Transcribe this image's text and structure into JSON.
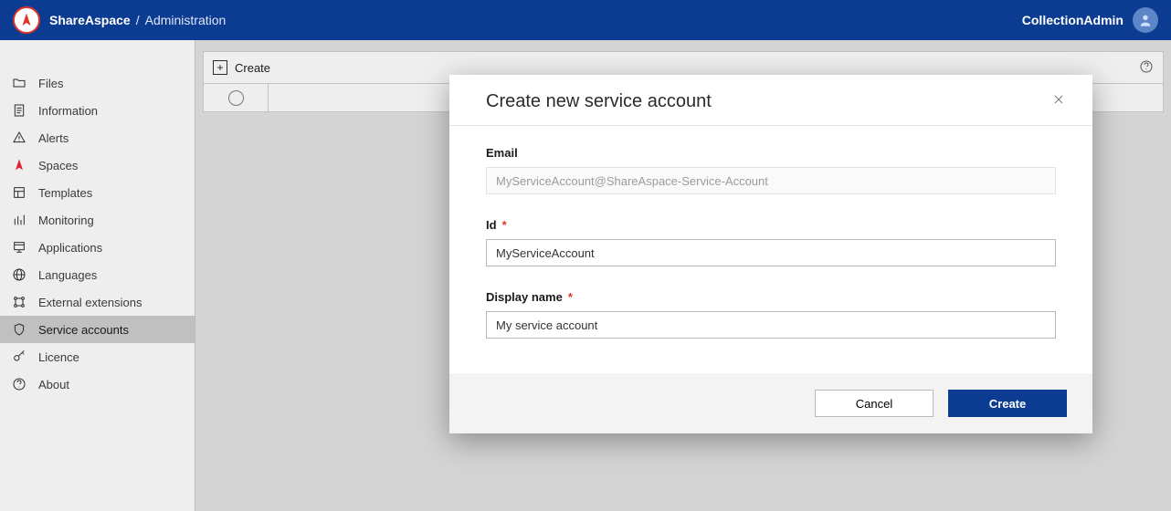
{
  "header": {
    "brand": "ShareAspace",
    "separator": "/",
    "section": "Administration",
    "user": "CollectionAdmin"
  },
  "sidebar": {
    "items": [
      {
        "icon": "folder-icon",
        "label": "Files"
      },
      {
        "icon": "document-icon",
        "label": "Information"
      },
      {
        "icon": "alert-icon",
        "label": "Alerts"
      },
      {
        "icon": "spaces-icon",
        "label": "Spaces"
      },
      {
        "icon": "template-icon",
        "label": "Templates"
      },
      {
        "icon": "monitoring-icon",
        "label": "Monitoring"
      },
      {
        "icon": "applications-icon",
        "label": "Applications"
      },
      {
        "icon": "globe-icon",
        "label": "Languages"
      },
      {
        "icon": "extensions-icon",
        "label": "External extensions"
      },
      {
        "icon": "shield-icon",
        "label": "Service accounts"
      },
      {
        "icon": "key-icon",
        "label": "Licence"
      },
      {
        "icon": "help-icon",
        "label": "About"
      }
    ],
    "active_index": 9
  },
  "toolbar": {
    "create_label": "Create"
  },
  "modal": {
    "title": "Create new service account",
    "email_label": "Email",
    "email_placeholder": "MyServiceAccount@ShareAspace-Service-Account",
    "id_label": "Id",
    "id_value": "MyServiceAccount",
    "display_label": "Display name",
    "display_value": "My service account",
    "cancel_label": "Cancel",
    "create_label": "Create"
  }
}
